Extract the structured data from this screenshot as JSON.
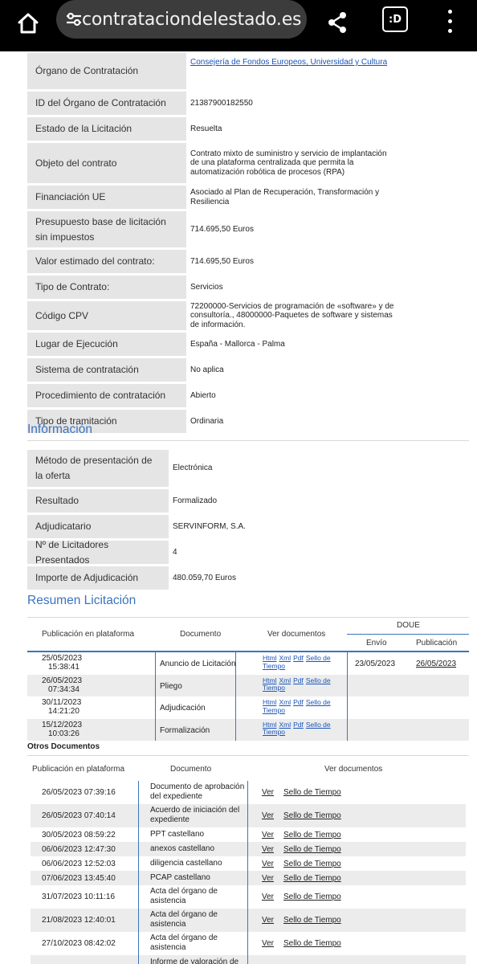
{
  "browser": {
    "url": "contrataciondelestado.es",
    "tabs_label": ":D"
  },
  "details": [
    {
      "label": "Órgano de Contratación",
      "value": "Consejería de Fondos Europeos, Universidad y Cultura",
      "link": true
    },
    {
      "label": "ID del Órgano de Contratación",
      "value": "21387900182550"
    },
    {
      "label": "Estado de la Licitación",
      "value": "Resuelta"
    },
    {
      "label": "Objeto del contrato",
      "value": "Contrato mixto de suministro y servicio de implantación de una plataforma centralizada que permita la automatización robótica de procesos (RPA)"
    },
    {
      "label": "Financiación UE",
      "value": "Asociado al Plan de Recuperación, Transformación y Resiliencia"
    },
    {
      "label": "Presupuesto base de licitación sin impuestos",
      "value": "714.695,50 Euros"
    },
    {
      "label": "Valor estimado del contrato:",
      "value": "714.695,50 Euros"
    },
    {
      "label": "Tipo de Contrato:",
      "value": "Servicios"
    },
    {
      "label": "Código CPV",
      "value": "72200000-Servicios de programación de «software» y de consultoría., 48000000-Paquetes de software y sistemas de información."
    },
    {
      "label": "Lugar de Ejecución",
      "value": "España - Mallorca - Palma"
    },
    {
      "label": "Sistema de contratación",
      "value": "No aplica"
    },
    {
      "label": "Procedimiento de contratación",
      "value": "Abierto"
    },
    {
      "label": "Tipo de tramitación",
      "value": "Ordinaria"
    }
  ],
  "informacion": {
    "title": "Información",
    "rows": [
      {
        "label": "Método de presentación de la oferta",
        "value": "Electrónica"
      },
      {
        "label": "Resultado",
        "value": "Formalizado"
      },
      {
        "label": "Adjudicatario",
        "value": "SERVINFORM, S.A."
      },
      {
        "label": "Nº de Licitadores Presentados",
        "value": "4"
      },
      {
        "label": "Importe de Adjudicación",
        "value": "480.059,70 Euros"
      }
    ]
  },
  "resumen": {
    "title": "Resumen Licitación",
    "headers": {
      "publicacion": "Publicación en plataforma",
      "documento": "Documento",
      "ver": "Ver documentos",
      "doue": "DOUE",
      "envio": "Envío",
      "publicacion_doue": "Publicación"
    },
    "link_labels": {
      "html": "Html",
      "xml": "Xml",
      "pdf": "Pdf",
      "sello": "Sello de Tiempo"
    },
    "rows": [
      {
        "date": "25/05/2023",
        "time": "15:38:41",
        "documento": "Anuncio de Licitación",
        "envio": "23/05/2023",
        "publicacion": "26/05/2023"
      },
      {
        "date": "26/05/2023",
        "time": "07:34:34",
        "documento": "Pliego",
        "envio": "",
        "publicacion": ""
      },
      {
        "date": "30/11/2023",
        "time": "14:21:20",
        "documento": "Adjudicación",
        "envio": "",
        "publicacion": ""
      },
      {
        "date": "15/12/2023",
        "time": "10:03:26",
        "documento": "Formalización",
        "envio": "",
        "publicacion": ""
      }
    ]
  },
  "otros": {
    "title": "Otros Documentos",
    "headers": {
      "publicacion": "Publicación en plataforma",
      "documento": "Documento",
      "ver": "Ver documentos"
    },
    "link_labels": {
      "ver": "Ver",
      "sello": "Sello de Tiempo"
    },
    "rows": [
      {
        "datetime": "26/05/2023 07:39:16",
        "documento": "Documento de aprobación del expediente"
      },
      {
        "datetime": "26/05/2023 07:40:14",
        "documento": "Acuerdo de iniciación del expediente"
      },
      {
        "datetime": "30/05/2023 08:59:22",
        "documento": "PPT castellano"
      },
      {
        "datetime": "06/06/2023 12:47:30",
        "documento": "anexos castellano"
      },
      {
        "datetime": "06/06/2023 12:52:03",
        "documento": "diligencia castellano"
      },
      {
        "datetime": "07/06/2023 13:45:40",
        "documento": "PCAP castellano"
      },
      {
        "datetime": "31/07/2023 10:11:16",
        "documento": "Acta del órgano de asistencia"
      },
      {
        "datetime": "21/08/2023 12:40:01",
        "documento": "Acta del órgano de asistencia"
      },
      {
        "datetime": "27/10/2023 08:42:02",
        "documento": "Acta del órgano de asistencia"
      },
      {
        "datetime": "",
        "documento": "Informe de valoración de"
      }
    ]
  }
}
